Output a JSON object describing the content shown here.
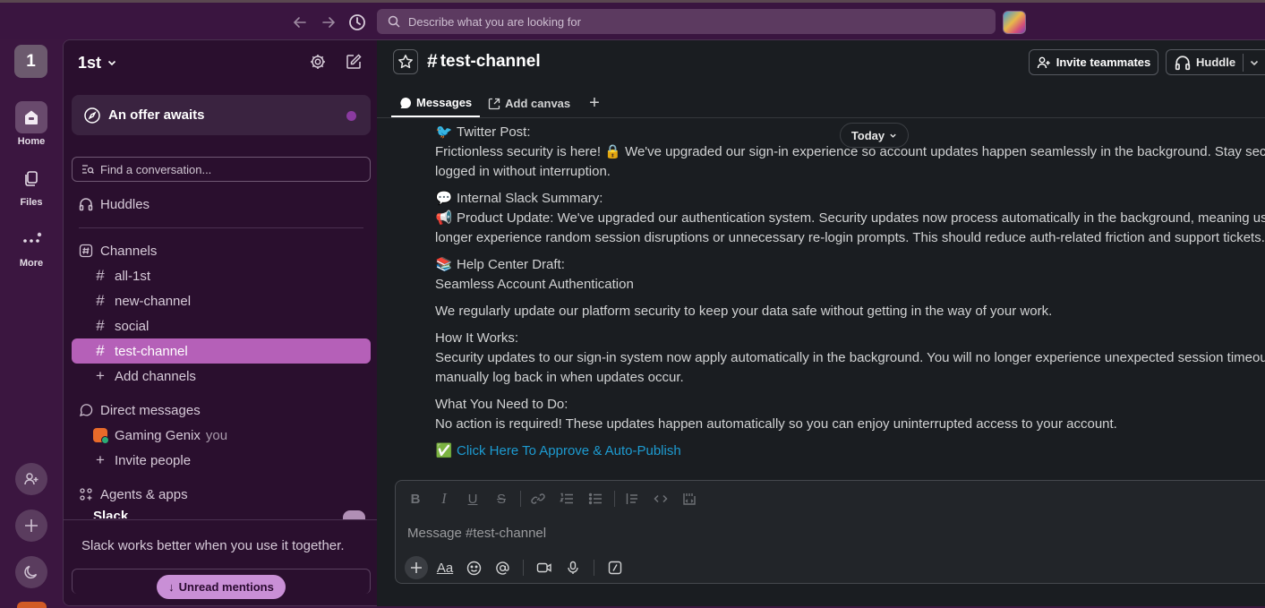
{
  "topbar": {
    "search_placeholder": "Describe what you are looking for"
  },
  "rail": {
    "workspace_initial": "1",
    "home_label": "Home",
    "files_label": "Files",
    "more_label": "More"
  },
  "sidebar": {
    "workspace_name": "1st",
    "offer_label": "An offer awaits",
    "find_placeholder": "Find a conversation...",
    "huddles_label": "Huddles",
    "channels_label": "Channels",
    "channels": [
      {
        "name": "all-1st"
      },
      {
        "name": "new-channel"
      },
      {
        "name": "social"
      },
      {
        "name": "test-channel"
      }
    ],
    "add_channels_label": "Add channels",
    "dm_label": "Direct messages",
    "dm_user": "Gaming Genix",
    "dm_you": "you",
    "invite_people_label": "Invite people",
    "agents_label": "Agents & apps",
    "slack_label": "Slack",
    "promo_text": "Slack works better when you use it together.",
    "unread_label": "Unread mentions"
  },
  "channel": {
    "name": "test-channel",
    "invite_label": "Invite teammates",
    "huddle_label": "Huddle",
    "tabs": [
      {
        "label": "Messages"
      },
      {
        "label": "Add canvas"
      }
    ],
    "today_label": "Today"
  },
  "message": {
    "twitter_heading": "Twitter Post:",
    "twitter_line1": "Frictionless security is here! 🔒 We've upgraded our sign-in experience so account updates happen seamlessly in the background. Stay secure",
    "twitter_line2": "logged in without interruption.",
    "summary_heading": "Internal Slack Summary:",
    "summary_line1": "Product Update: We've upgraded our authentication system. Security updates now process automatically in the background, meaning user",
    "summary_line2": "longer experience random session disruptions or unnecessary re-login prompts. This should reduce auth-related friction and support tickets.",
    "help_heading": "Help Center Draft:",
    "help_title": "Seamless Account Authentication",
    "help_intro": "We regularly update our platform security to keep your data safe without getting in the way of your work.",
    "how_heading": "How It Works:",
    "how_line1": "Security updates to our sign-in system now apply automatically in the background. You will no longer experience unexpected session timeouts",
    "how_line2": "manually log back in when updates occur.",
    "need_heading": "What You Need to Do:",
    "need_line": "No action is required! These updates happen automatically so you can enjoy uninterrupted access to your account.",
    "link_text": "Click Here To Approve & Auto-Publish"
  },
  "composer": {
    "placeholder": "Message #test-channel"
  },
  "colors": {
    "aubergine": "#3b1640",
    "sidebar_bg": "#2a0f2e",
    "active_channel": "#b560b8",
    "link": "#1d9bd1",
    "main_bg": "#1a1d21"
  }
}
